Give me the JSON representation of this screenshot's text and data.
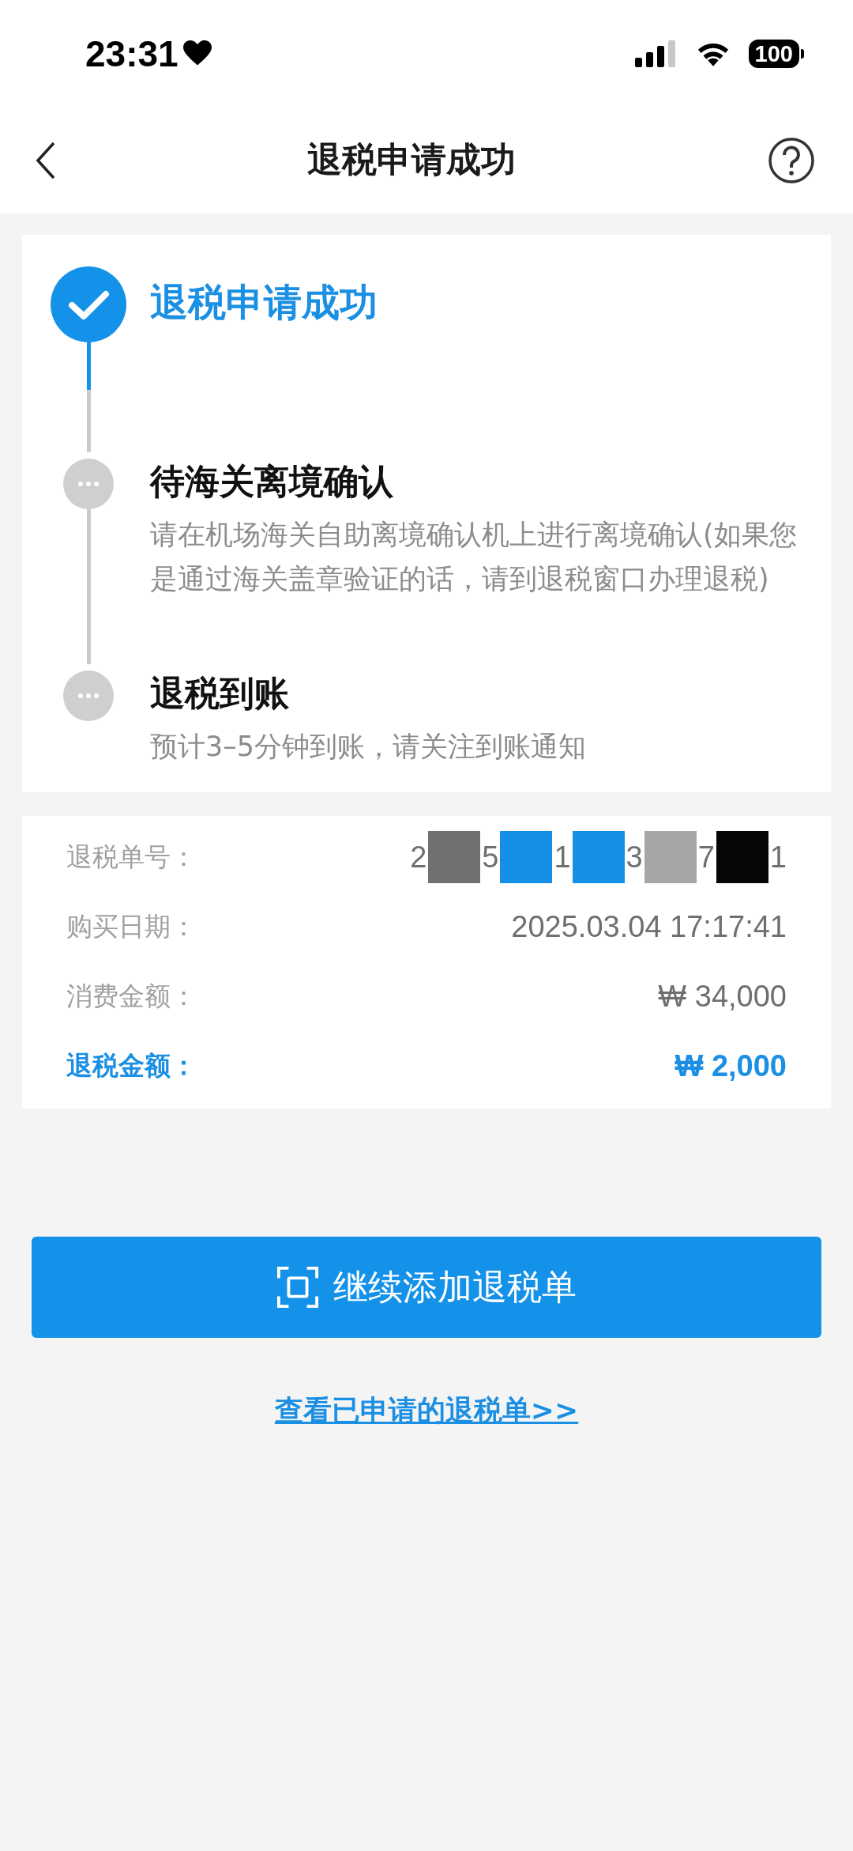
{
  "status_bar": {
    "time": "23:31",
    "battery": "100"
  },
  "nav": {
    "title": "退税申请成功"
  },
  "steps": [
    {
      "title": "退税申请成功",
      "done": true
    },
    {
      "title": "待海关离境确认",
      "description": "请在机场海关自助离境确认机上进行离境确认(如果您是通过海关盖章验证的话，请到退税窗口办理退税)",
      "done": false
    },
    {
      "title": "退税到账",
      "description": "预计3–5分钟到账，请关注到账通知",
      "done": false
    }
  ],
  "details": [
    {
      "label": "退税单号：",
      "kind": "redacted",
      "segments": [
        {
          "text": "2"
        },
        {
          "color": "#707070"
        },
        {
          "text": "5"
        },
        {
          "color": "#1490e6"
        },
        {
          "text": "1"
        },
        {
          "color": "#1490e6"
        },
        {
          "text": "3"
        },
        {
          "color": "#a6a6a6"
        },
        {
          "text": "7"
        },
        {
          "color": "#060606"
        },
        {
          "text": "1"
        }
      ],
      "highlight": false
    },
    {
      "label": "购买日期：",
      "kind": "text",
      "value": "2025.03.04 17:17:41",
      "highlight": false
    },
    {
      "label": "消费金额：",
      "kind": "text",
      "value": "₩ 34,000",
      "highlight": false
    },
    {
      "label": "退税金额：",
      "kind": "text",
      "value": "₩ 2,000",
      "highlight": true
    }
  ],
  "primary_button": {
    "label": "继续添加退税单"
  },
  "link": {
    "label": "查看已申请的退税单>>"
  }
}
